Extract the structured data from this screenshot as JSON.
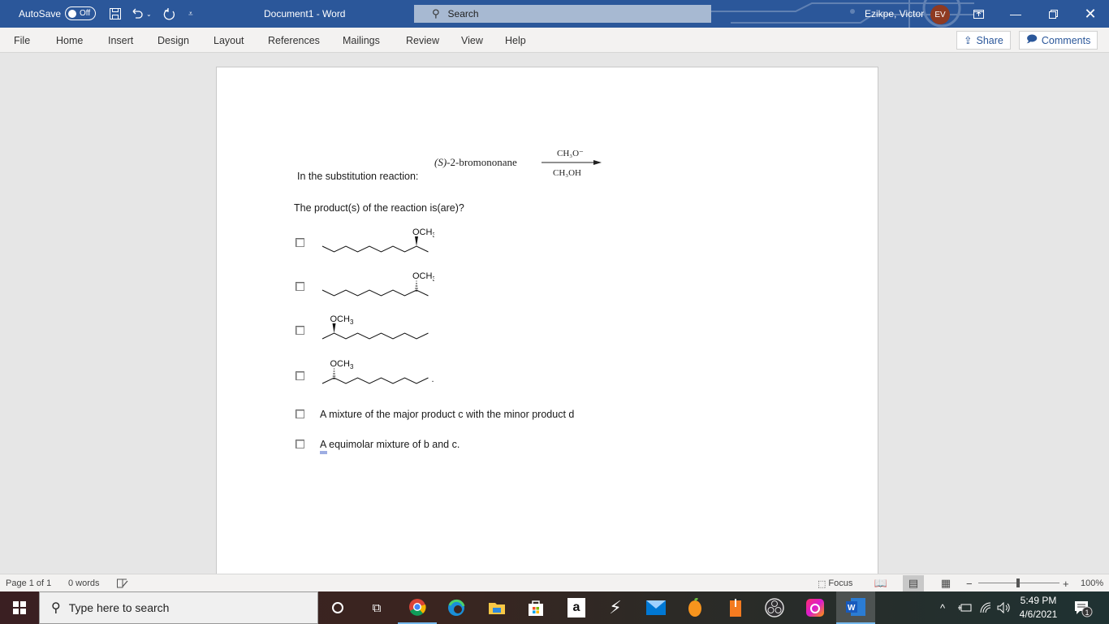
{
  "titlebar": {
    "autosave_label": "AutoSave",
    "autosave_state": "Off",
    "document_title": "Document1  -  Word",
    "search_placeholder": "Search",
    "user_name": "Ezikpe, Victor",
    "user_initials": "EV",
    "icons": [
      "save-icon",
      "undo-icon",
      "redo-icon",
      "customize-qat-icon",
      "ribbon-display-icon",
      "minimize-icon",
      "restore-icon",
      "close-icon"
    ],
    "accent_color": "#2b579a"
  },
  "ribbon": {
    "tabs": [
      "File",
      "Home",
      "Insert",
      "Design",
      "Layout",
      "References",
      "Mailings",
      "Review",
      "View",
      "Help"
    ],
    "share_label": "Share",
    "comments_label": "Comments"
  },
  "document": {
    "reaction": {
      "reactant": "-2-bromononane",
      "stereo_prefix": "(S)",
      "reagent_top": "CH₃O⁻",
      "reagent_bottom": "CH₃OH"
    },
    "intro_text": "In the substitution reaction:",
    "question": "The product(s) of the reaction is(are)?",
    "substituent_label": "OCH",
    "substituent_subscript": "3",
    "options": [
      {
        "id": "a",
        "type": "structure",
        "description": "2-methoxynonane, OCH3 on wedge bond, substituent at right end",
        "checked": false
      },
      {
        "id": "b",
        "type": "structure",
        "description": "2-methoxynonane, OCH3 on hashed bond, substituent at right end",
        "checked": false
      },
      {
        "id": "c",
        "type": "structure",
        "description": "2-methoxynonane, OCH3 on wedge bond, substituent at left end",
        "checked": false
      },
      {
        "id": "d",
        "type": "structure",
        "description": "2-methoxynonane, OCH3 on hashed bond, substituent at left end",
        "checked": false
      },
      {
        "id": "e",
        "type": "text",
        "text": "A mixture of the major product c with the minor product d",
        "checked": false
      },
      {
        "id": "f",
        "type": "text",
        "text": "A equimolar mixture of b and c.",
        "checked": false
      }
    ],
    "trailing_period": "."
  },
  "statusbar": {
    "page_info": "Page 1 of 1",
    "word_count": "0 words",
    "focus_label": "Focus",
    "zoom_level": "100%",
    "zoom_minus": "−",
    "zoom_plus": "+"
  },
  "taskbar": {
    "search_placeholder": "Type here to search",
    "apps": [
      "cortana",
      "task-view",
      "chrome",
      "edge",
      "file-explorer",
      "microsoft-store",
      "amazon",
      "app-lightning",
      "mail",
      "fl-studio",
      "app-orange",
      "obs",
      "creative-cloud",
      "word"
    ],
    "time": "5:49 PM",
    "date": "4/6/2021",
    "notification_count": "1"
  }
}
